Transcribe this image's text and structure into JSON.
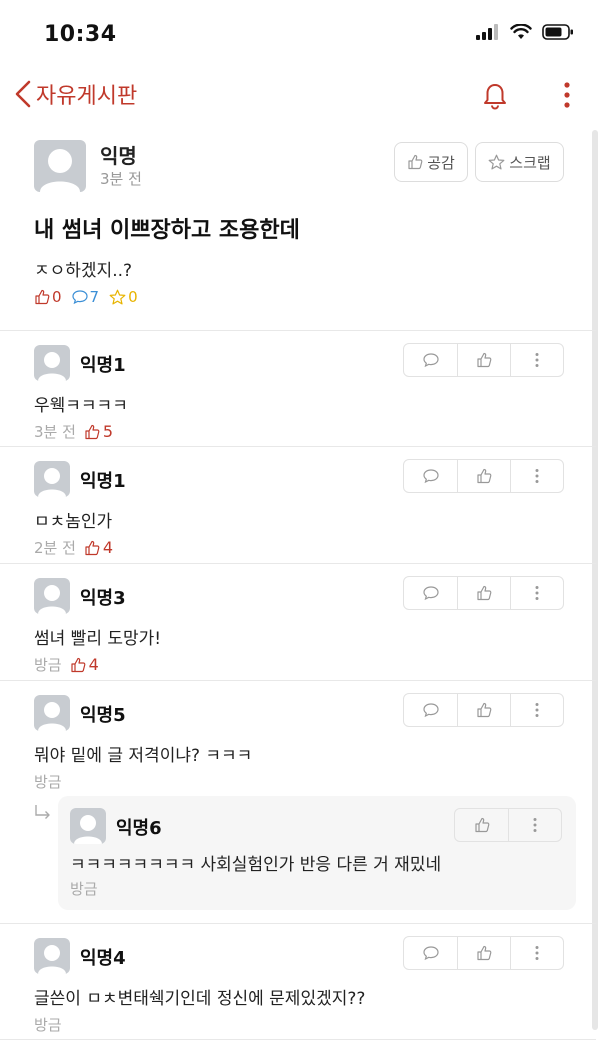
{
  "status": {
    "time": "10:34"
  },
  "nav": {
    "title": "자유게시판"
  },
  "post": {
    "author": "익명",
    "time": "3분 전",
    "like_label": "공감",
    "scrap_label": "스크랩",
    "title": "내 썸녀 이쁘장하고 조용한데",
    "body": "ㅈㅇ하겠지..?",
    "likes": "0",
    "comments": "7",
    "scraps": "0"
  },
  "comments": [
    {
      "author": "익명1",
      "text": "우웩ㅋㅋㅋㅋ",
      "time": "3분 전",
      "likes": "5"
    },
    {
      "author": "익명1",
      "text": "ㅁㅊ놈인가",
      "time": "2분 전",
      "likes": "4"
    },
    {
      "author": "익명3",
      "text": "썸녀 빨리 도망가!",
      "time": "방금",
      "likes": "4"
    },
    {
      "author": "익명5",
      "text": "뭐야 밑에 글 저격이냐? ㅋㅋㅋ",
      "time": "방금",
      "likes": ""
    },
    {
      "author": "익명4",
      "text": "글쓴이 ㅁㅊ변태쉑기인데 정신에 문제있겠지??",
      "time": "방금",
      "likes": ""
    }
  ],
  "reply": {
    "author": "익명6",
    "text": "ㅋㅋㅋㅋㅋㅋㅋㅋ 사회실험인가 반응 다른 거 재밌네",
    "time": "방금"
  },
  "colors": {
    "accent": "#c0392b",
    "comment_blue": "#3b8fd6",
    "scrap_yellow": "#e8b400"
  }
}
